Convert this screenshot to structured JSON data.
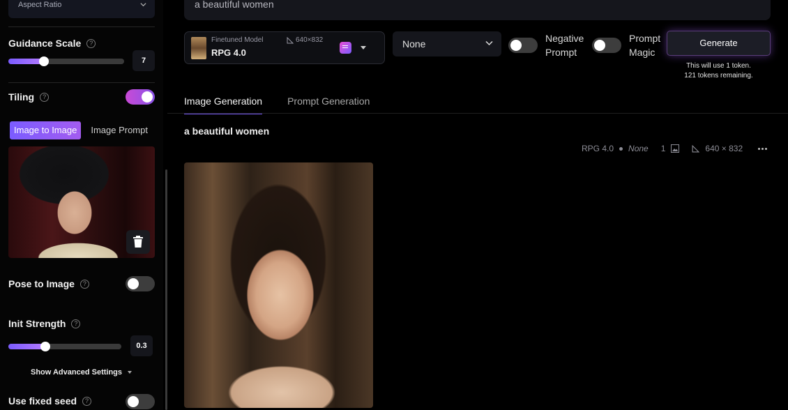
{
  "sidebar": {
    "aspect_ratio_label": "Aspect Ratio",
    "guidance_scale": {
      "label": "Guidance Scale",
      "value": "7",
      "fraction": 0.31
    },
    "tiling": {
      "label": "Tiling",
      "on": true
    },
    "image_tabs": [
      {
        "label": "Image to Image",
        "active": true
      },
      {
        "label": "Image Prompt",
        "active": false
      }
    ],
    "pose_to_image": {
      "label": "Pose to Image",
      "on": false
    },
    "init_strength": {
      "label": "Init Strength",
      "value": "0.3",
      "fraction": 0.33
    },
    "advanced_label": "Show Advanced Settings",
    "fixed_seed": {
      "label": "Use fixed seed",
      "on": false
    },
    "help_glyph": "?"
  },
  "prompt": {
    "text": "a beautiful women"
  },
  "model": {
    "kind": "Finetuned Model",
    "name": "RPG 4.0",
    "dimensions": "640×832"
  },
  "style_select": {
    "value": "None"
  },
  "toggles": {
    "negative_prompt": {
      "line1": "Negative",
      "line2": "Prompt",
      "on": false
    },
    "prompt_magic": {
      "line1": "Prompt",
      "line2": "Magic",
      "on": false
    }
  },
  "generate": {
    "label": "Generate",
    "token_line1": "This will use 1 token.",
    "token_line2": "121 tokens remaining."
  },
  "main_tabs": [
    {
      "label": "Image Generation",
      "active": true
    },
    {
      "label": "Prompt Generation",
      "active": false
    }
  ],
  "generation": {
    "title": "a beautiful women",
    "model": "RPG 4.0",
    "style": "None",
    "count": "1",
    "dimensions": "640 × 832"
  },
  "colors": {
    "accent": "#7b5cff",
    "accent_pink": "#c94ad6",
    "background": "#000000",
    "panel": "#15161c"
  },
  "icons": [
    "chevron-down-icon",
    "help-icon",
    "trash-icon",
    "dimension-icon",
    "prompt-list-icon",
    "image-count-icon",
    "more-icon"
  ]
}
